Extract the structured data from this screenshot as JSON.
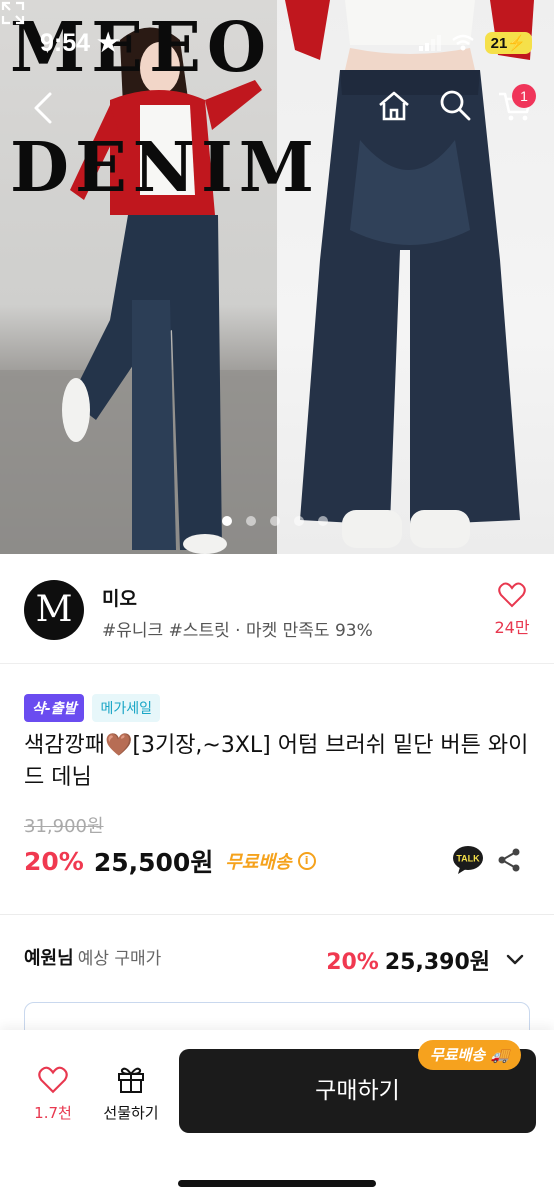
{
  "status_bar": {
    "time": "9:54",
    "battery": "21"
  },
  "hero": {
    "brand_line1": "MEEO",
    "brand_line2": "DENIM",
    "image_count": 5,
    "active_index": 0
  },
  "top_nav": {
    "cart_count": "1"
  },
  "seller": {
    "logo_letter": "M",
    "name": "미오",
    "tags": "#유니크 #스트릿 · 마켓 만족도 93%",
    "like_count": "24만"
  },
  "product": {
    "badge_sale": "샥-출발",
    "badge_mega": "메가세일",
    "title_prefix": "색감깡패",
    "title_emoji": "🤎",
    "title_rest": "[3기장,~3XL] 어텀 브러쉬 밑단 버튼 와이드 데님",
    "original_price": "31,900원",
    "discount": "20%",
    "price": "25,500원",
    "free_shipping": "무료배송",
    "info_icon": "i"
  },
  "member": {
    "name": "예원님",
    "label": "예상 구매가",
    "discount": "20%",
    "price": "25,390원"
  },
  "bottom_bar": {
    "like_count": "1.7천",
    "gift_label": "선물하기",
    "buy_label": "구매하기",
    "ship_tag": "무료배송"
  },
  "colors": {
    "accent_red": "#f03950",
    "shipping_orange": "#f5a21c",
    "dark_button": "#1b1b1b"
  }
}
